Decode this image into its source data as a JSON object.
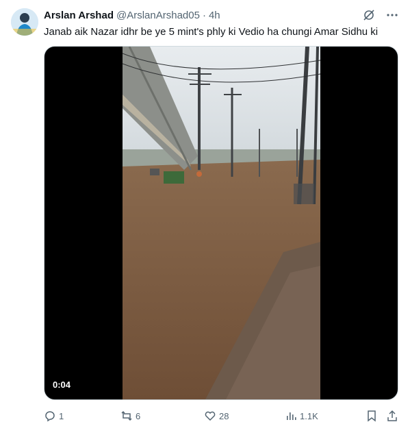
{
  "author": {
    "name": "Arslan Arshad",
    "handle": "@ArslanArshad05",
    "separator": "·",
    "time": "4h"
  },
  "tweet": {
    "text": "Janab aik Nazar idhr be ye 5 mint's phly ki Vedio ha chungi Amar Sidhu ki"
  },
  "media": {
    "duration": "0:04"
  },
  "actions": {
    "replies": "1",
    "reposts": "6",
    "likes": "28",
    "views": "1.1K"
  },
  "icons": {
    "grok": "grok-icon",
    "more": "more-icon",
    "reply": "reply-icon",
    "repost": "repost-icon",
    "like": "heart-icon",
    "views": "views-icon",
    "bookmark": "bookmark-icon",
    "share": "share-icon"
  },
  "colors": {
    "text_primary": "#0f1419",
    "text_secondary": "#536471",
    "border": "#cfd9de"
  }
}
